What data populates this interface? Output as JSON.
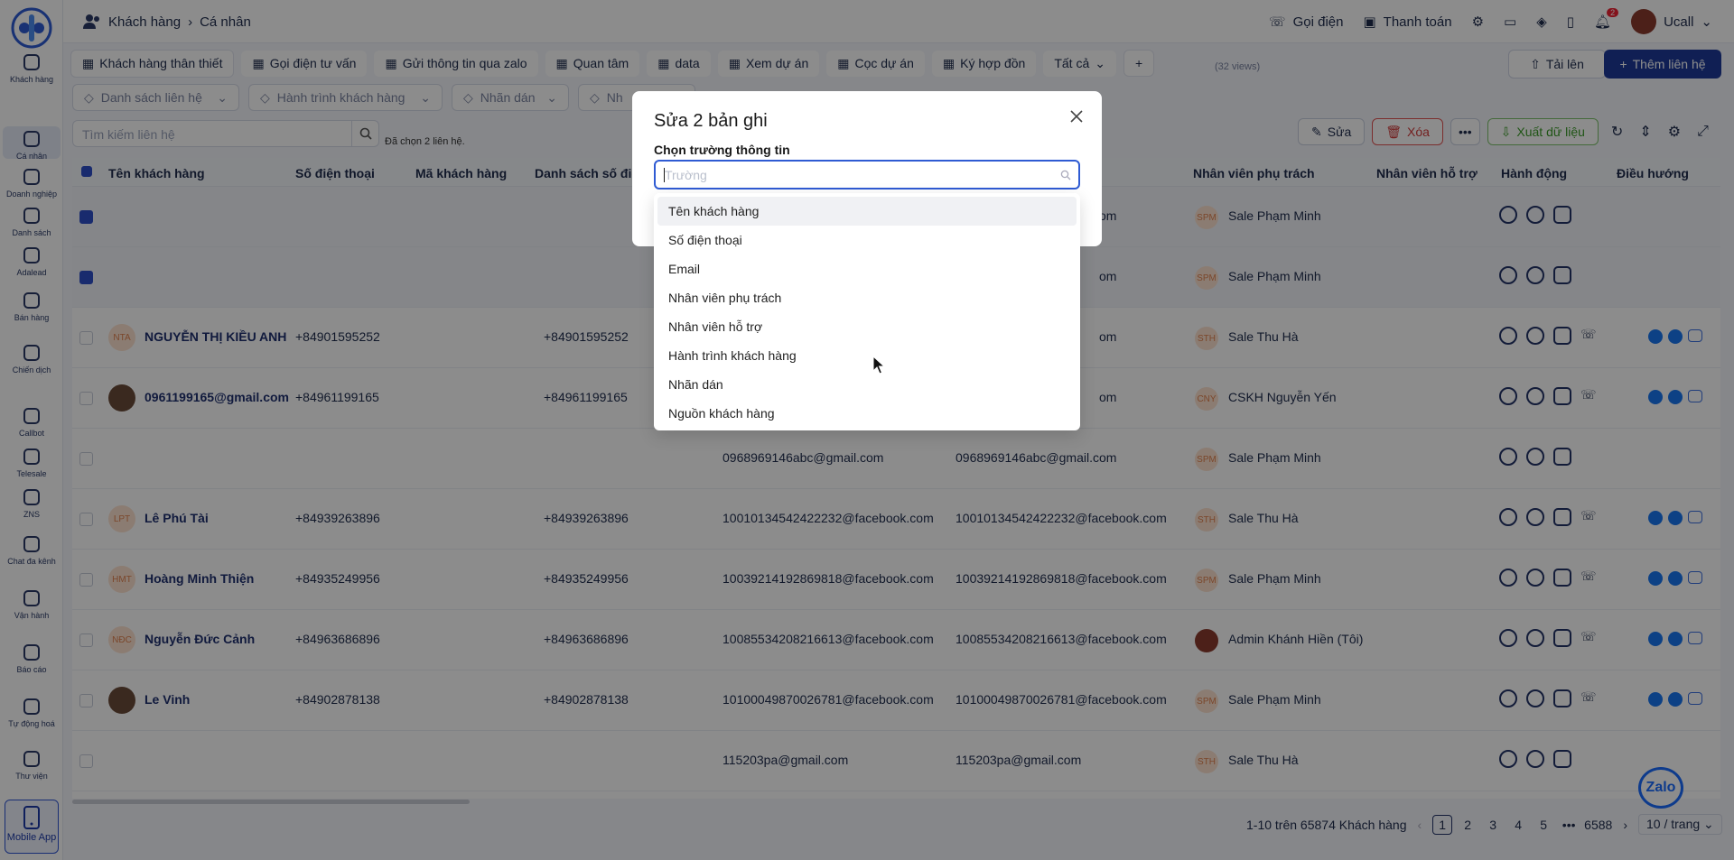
{
  "breadcrumb": {
    "root": "Khách hàng",
    "current": "Cá nhân"
  },
  "topbar": {
    "call": "Gọi điện",
    "pay": "Thanh toán",
    "badge": "2",
    "user": "Ucall"
  },
  "sidebar": {
    "items": [
      {
        "label": "Khách hàng",
        "icon": "contacts-icon"
      },
      {
        "label": "Cá nhân",
        "icon": "person-icon"
      },
      {
        "label": "Doanh nghiệp",
        "icon": "building-icon"
      },
      {
        "label": "Danh sách",
        "icon": "list-icon"
      },
      {
        "label": "Adalead",
        "icon": "adalead-icon"
      },
      {
        "label": "Bán hàng",
        "icon": "sales-icon"
      },
      {
        "label": "Chiến dịch",
        "icon": "campaign-icon"
      },
      {
        "label": "Callbot",
        "icon": "phone-icon"
      },
      {
        "label": "Telesale",
        "icon": "headset-icon"
      },
      {
        "label": "ZNS",
        "icon": "send-icon"
      },
      {
        "label": "Chat đa kênh",
        "icon": "chat-icon"
      },
      {
        "label": "Vận hành",
        "icon": "briefcase-icon"
      },
      {
        "label": "Báo cáo",
        "icon": "report-icon"
      },
      {
        "label": "Tự động hoá",
        "icon": "automation-icon"
      },
      {
        "label": "Thư viện",
        "icon": "library-icon"
      }
    ],
    "mobile": "Mobile App"
  },
  "tabs": [
    "Khách hàng thân thiết",
    "Gọi điện tư vấn",
    "Gửi thông tin qua zalo",
    "Quan tâm",
    "data",
    "Xem dự án",
    "Cọc dự án",
    "Ký hợp đồn"
  ],
  "tabs_all": "Tất cả",
  "views": "(32 views)",
  "upload": "Tải lên",
  "add_contact": "Thêm liên hệ",
  "filters": [
    "Danh sách liên hệ",
    "Hành trình khách hàng",
    "Nhãn dán",
    "Nh"
  ],
  "search_placeholder": "Tìm kiếm liên hệ",
  "selected_text": "Đã chọn 2 liên hệ.",
  "actions": {
    "edit": "Sửa",
    "delete": "Xóa",
    "export": "Xuất dữ liệu"
  },
  "columns": [
    "Tên khách hàng",
    "Số điện thoại",
    "Mã khách hàng",
    "Danh sách số điệ",
    "Nhân viên phụ trách",
    "Nhân viên hỗ trợ",
    "Hành động",
    "Điều hướng"
  ],
  "rows": [
    {
      "sel": true,
      "initials": "",
      "name": "",
      "phone": "",
      "phones": "",
      "email": "",
      "email2": "om",
      "staff_av": "SPM",
      "staff": "Sale Phạm Minh",
      "phone_icon": false
    },
    {
      "sel": true,
      "initials": "",
      "name": "",
      "phone": "",
      "phones": "",
      "email": "",
      "email2": "om",
      "staff_av": "SPM",
      "staff": "Sale Phạm Minh",
      "phone_icon": false
    },
    {
      "sel": false,
      "initials": "NTA",
      "name": "NGUYỄN THỊ KIỀU ANH",
      "phone": "+84901595252",
      "phones": "+84901595252",
      "email": "",
      "email2": "om",
      "staff_av": "STH",
      "staff": "Sale Thu Hà",
      "phone_icon": true
    },
    {
      "sel": false,
      "initials": "",
      "name": "0961199165@gmail.com",
      "phone": "+84961199165",
      "phones": "+84961199165",
      "email": "",
      "email2": "om",
      "staff_av": "CNY",
      "staff": "CSKH Nguyễn Yến",
      "phone_icon": true
    },
    {
      "sel": false,
      "initials": "",
      "name": "",
      "phone": "",
      "phones": "",
      "email": "0968969146abc@gmail.com",
      "email2": "0968969146abc@gmail.com",
      "staff_av": "SPM",
      "staff": "Sale Phạm Minh",
      "phone_icon": false
    },
    {
      "sel": false,
      "initials": "LPT",
      "name": "Lê Phú Tài",
      "phone": "+84939263896",
      "phones": "+84939263896",
      "email": "10010134542422232@facebook.com",
      "email2": "10010134542422232@facebook.com",
      "staff_av": "STH",
      "staff": "Sale Thu Hà",
      "phone_icon": true
    },
    {
      "sel": false,
      "initials": "HMT",
      "name": "Hoàng Minh Thiện",
      "phone": "+84935249956",
      "phones": "+84935249956",
      "email": "10039214192869818@facebook.com",
      "email2": "10039214192869818@facebook.com",
      "staff_av": "SPM",
      "staff": "Sale Phạm Minh",
      "phone_icon": true
    },
    {
      "sel": false,
      "initials": "NĐC",
      "name": "Nguyễn Đức Cảnh",
      "phone": "+84963686896",
      "phones": "+84963686896",
      "email": "10085534208216613@facebook.com",
      "email2": "10085534208216613@facebook.com",
      "staff_av": "",
      "staff": "Admin Khánh Hiền (Tôi)",
      "phone_icon": true
    },
    {
      "sel": false,
      "initials": "",
      "name": "Le Vinh",
      "phone": "+84902878138",
      "phones": "+84902878138",
      "email": "10100049870026781@facebook.com",
      "email2": "10100049870026781@facebook.com",
      "staff_av": "SPM",
      "staff": "Sale Phạm Minh",
      "phone_icon": true
    },
    {
      "sel": false,
      "initials": "",
      "name": "",
      "phone": "",
      "phones": "",
      "email": "115203pa@gmail.com",
      "email2": "115203pa@gmail.com",
      "staff_av": "STH",
      "staff": "Sale Thu Hà",
      "phone_icon": false
    }
  ],
  "pagination": {
    "summary": "1-10 trên 65874 Khách hàng",
    "pages": [
      "1",
      "2",
      "3",
      "4",
      "5",
      "•••",
      "6588"
    ],
    "page_size": "10 / trang"
  },
  "zalo": "Zalo",
  "modal": {
    "title": "Sửa 2 bản ghi",
    "field_label": "Chọn trường thông tin",
    "placeholder": "Trường",
    "options": [
      "Tên khách hàng",
      "Số điện thoại",
      "Email",
      "Nhân viên phụ trách",
      "Nhân viên hỗ trợ",
      "Hành trình khách hàng",
      "Nhãn dán",
      "Nguồn khách hàng"
    ]
  },
  "colors": {
    "primary": "#1e3a9a",
    "accent": "#2f5bd3",
    "danger": "#d23b3b",
    "success": "#3b9b28"
  }
}
